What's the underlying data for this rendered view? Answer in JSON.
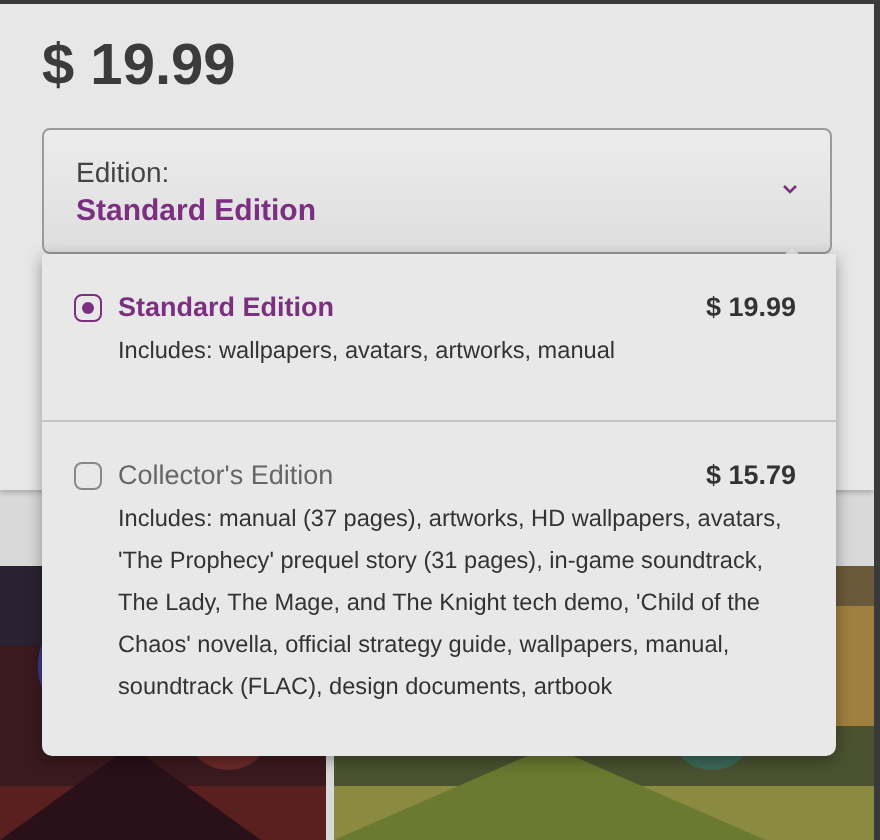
{
  "price": "$ 19.99",
  "select": {
    "label": "Edition:",
    "value": "Standard Edition",
    "expanded": true
  },
  "options": [
    {
      "name": "Standard Edition",
      "price": "$ 19.99",
      "includes": "Includes: wallpapers, avatars, artworks, manual",
      "selected": true
    },
    {
      "name": "Collector's Edition",
      "price": "$ 15.79",
      "includes": "Includes: manual (37 pages), artworks, HD wallpapers, avatars, 'The Prophecy' prequel story (31 pages), in-game soundtrack, The Lady, The Mage, and The Knight tech demo, 'Child of the Chaos' novella, official strategy guide, wallpapers, manual, soundtrack (FLAC), design documents, artbook",
      "selected": false
    }
  ]
}
